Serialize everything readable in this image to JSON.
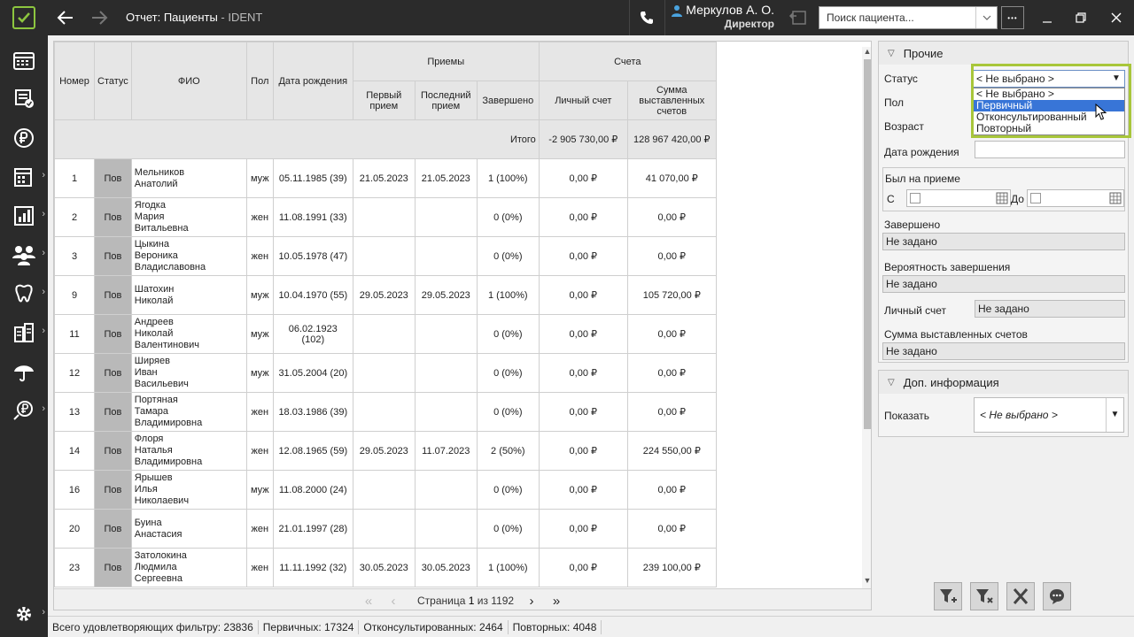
{
  "titlebar": {
    "title": "Отчет: Пациенты",
    "subtitle": " - IDENT",
    "user_name": "Меркулов А. О.",
    "user_role": "Директор",
    "search_placeholder": "Поиск пациента...",
    "more_label": "•••"
  },
  "colors": {
    "accent": "#8dc63f",
    "dark": "#2b2b2b",
    "highlight": "#3875d7",
    "callout": "#a8c63a"
  },
  "sidebar": {
    "items": [
      {
        "icon": "schedule-icon"
      },
      {
        "icon": "tasks-icon"
      },
      {
        "icon": "ruble-icon"
      },
      {
        "icon": "calendar-icon"
      },
      {
        "icon": "reports-icon"
      },
      {
        "icon": "patients-icon"
      },
      {
        "icon": "tooth-icon"
      },
      {
        "icon": "warehouse-icon"
      },
      {
        "icon": "insurance-icon"
      },
      {
        "icon": "finance-icon"
      },
      {
        "icon": "settings-icon"
      }
    ]
  },
  "table": {
    "headers": {
      "number": "Номер",
      "status": "Статус",
      "fio": "ФИО",
      "gender": "Пол",
      "birth": "Дата рождения",
      "visits": "Приемы",
      "first": "Первый прием",
      "last": "Последний прием",
      "completed": "Завершено",
      "bills": "Счета",
      "personal": "Личный счет",
      "sum": "Сумма выставленных счетов"
    },
    "total": {
      "label": "Итого",
      "personal": "-2 905 730,00 ₽",
      "sum": "128 967 420,00 ₽"
    },
    "rows": [
      {
        "num": "1",
        "status": "Пов",
        "fio1": "Мельников",
        "fio2": "Анатолий",
        "fio3": "",
        "gender": "муж",
        "birth": "05.11.1985 (39)",
        "first": "21.05.2023",
        "last": "21.05.2023",
        "completed": "1 (100%)",
        "personal": "0,00 ₽",
        "sum": "41 070,00 ₽"
      },
      {
        "num": "2",
        "status": "Пов",
        "fio1": "Ягодка",
        "fio2": "Мария",
        "fio3": "Витальевна",
        "gender": "жен",
        "birth": "11.08.1991 (33)",
        "first": "",
        "last": "",
        "completed": "0 (0%)",
        "personal": "0,00 ₽",
        "sum": "0,00 ₽"
      },
      {
        "num": "3",
        "status": "Пов",
        "fio1": "Цыкина",
        "fio2": "Вероника",
        "fio3": "Владиславовна",
        "gender": "жен",
        "birth": "10.05.1978 (47)",
        "first": "",
        "last": "",
        "completed": "0 (0%)",
        "personal": "0,00 ₽",
        "sum": "0,00 ₽"
      },
      {
        "num": "9",
        "status": "Пов",
        "fio1": "Шатохин",
        "fio2": "Николай",
        "fio3": "",
        "gender": "муж",
        "birth": "10.04.1970 (55)",
        "first": "29.05.2023",
        "last": "29.05.2023",
        "completed": "1 (100%)",
        "personal": "0,00 ₽",
        "sum": "105 720,00 ₽"
      },
      {
        "num": "11",
        "status": "Пов",
        "fio1": "Андреев",
        "fio2": "Николай",
        "fio3": "Валентинович",
        "gender": "муж",
        "birth": "06.02.1923 (102)",
        "first": "",
        "last": "",
        "completed": "0 (0%)",
        "personal": "0,00 ₽",
        "sum": "0,00 ₽"
      },
      {
        "num": "12",
        "status": "Пов",
        "fio1": "Ширяев",
        "fio2": "Иван",
        "fio3": "Васильевич",
        "gender": "муж",
        "birth": "31.05.2004 (20)",
        "first": "",
        "last": "",
        "completed": "0 (0%)",
        "personal": "0,00 ₽",
        "sum": "0,00 ₽"
      },
      {
        "num": "13",
        "status": "Пов",
        "fio1": "Портяная",
        "fio2": "Тамара",
        "fio3": "Владимировна",
        "gender": "жен",
        "birth": "18.03.1986 (39)",
        "first": "",
        "last": "",
        "completed": "0 (0%)",
        "personal": "0,00 ₽",
        "sum": "0,00 ₽"
      },
      {
        "num": "14",
        "status": "Пов",
        "fio1": "Флоря",
        "fio2": "Наталья",
        "fio3": "Владимировна",
        "gender": "жен",
        "birth": "12.08.1965 (59)",
        "first": "29.05.2023",
        "last": "11.07.2023",
        "completed": "2 (50%)",
        "personal": "0,00 ₽",
        "sum": "224 550,00 ₽"
      },
      {
        "num": "16",
        "status": "Пов",
        "fio1": "Ярышев",
        "fio2": "Илья",
        "fio3": "Николаевич",
        "gender": "муж",
        "birth": "11.08.2000 (24)",
        "first": "",
        "last": "",
        "completed": "0 (0%)",
        "personal": "0,00 ₽",
        "sum": "0,00 ₽"
      },
      {
        "num": "20",
        "status": "Пов",
        "fio1": "Буина",
        "fio2": "Анастасия",
        "fio3": "",
        "gender": "жен",
        "birth": "21.01.1997 (28)",
        "first": "",
        "last": "",
        "completed": "0 (0%)",
        "personal": "0,00 ₽",
        "sum": "0,00 ₽"
      },
      {
        "num": "23",
        "status": "Пов",
        "fio1": "Затолокина",
        "fio2": "Людмила",
        "fio3": "Сергеевна",
        "gender": "жен",
        "birth": "11.11.1992 (32)",
        "first": "30.05.2023",
        "last": "30.05.2023",
        "completed": "1 (100%)",
        "personal": "0,00 ₽",
        "sum": "239 100,00 ₽"
      }
    ]
  },
  "pager": {
    "prefix": "Страница ",
    "current": "1",
    "sep": " из ",
    "total": "1192"
  },
  "filters": {
    "section_other": "Прочие",
    "status_label": "Статус",
    "status_value": "< Не выбрано >",
    "status_options": [
      "< Не выбрано >",
      "Первичный",
      "Отконсультированный",
      "Повторный"
    ],
    "status_highlighted": "Первичный",
    "gender_label": "Пол",
    "age_label": "Возраст",
    "birth_label": "Дата рождения",
    "visited_label": "Был на приеме",
    "from_label": "С",
    "to_label": "До",
    "completed_label": "Завершено",
    "completed_value": "Не задано",
    "probability_label": "Вероятность завершения",
    "probability_value": "Не задано",
    "personal_label": "Личный счет",
    "personal_value": "Не задано",
    "sum_label": "Сумма выставленных счетов",
    "sum_value": "Не задано",
    "section_extra": "Доп. информация",
    "show_label": "Показать",
    "show_value": "< Не выбрано >"
  },
  "statusbar": {
    "total": "Всего удовлетворяющих фильтру: 23836",
    "primary": "Первичных: 17324",
    "consulted": "Отконсультированных: 2464",
    "repeat": "Повторных: 4048"
  }
}
